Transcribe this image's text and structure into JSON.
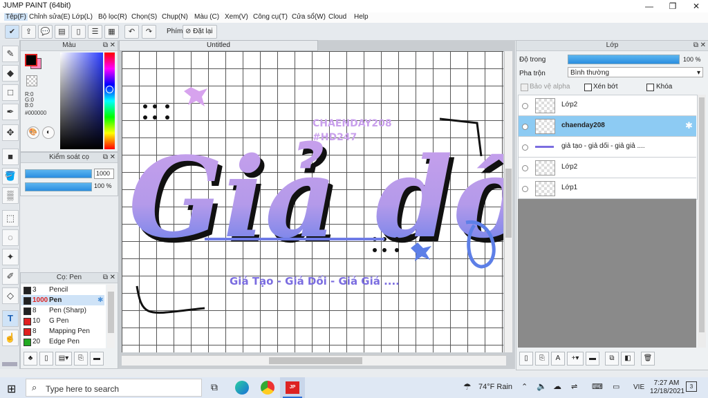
{
  "window": {
    "title": "JUMP PAINT (64bit)",
    "min": "—",
    "max": "❐",
    "close": "✕"
  },
  "menu": [
    "Tệp(F)",
    "Chỉnh sửa(E)",
    "Lớp(L)",
    "Bộ lọc(R)",
    "Chọn(S)",
    "Chụp(N)",
    "Màu (C)",
    "Xem(V)",
    "Công cụ(T)",
    "Cửa sổ(W)",
    "Cloud",
    "Help"
  ],
  "toolbar": {
    "phim_label": "Phím",
    "reset_label": "Đặt lại"
  },
  "color_panel": {
    "title": "Màu",
    "r": "R:0",
    "g": "G:0",
    "b": "B:0",
    "hex": "#000000",
    "fg": "#000000",
    "bg": "#ff88bb"
  },
  "pen_control": {
    "title": "Kiểm soát cọ",
    "size": "1000",
    "opacity": "100 %"
  },
  "brush_panel": {
    "title": "Cọ: Pen",
    "items": [
      {
        "size": "3",
        "name": "Pencil",
        "color": "#222222"
      },
      {
        "size": "1000",
        "name": "Pen",
        "color": "#222222",
        "selected": true
      },
      {
        "size": "8",
        "name": "Pen (Sharp)",
        "color": "#222222"
      },
      {
        "size": "10",
        "name": "G Pen",
        "color": "#e02020"
      },
      {
        "size": "8",
        "name": "Mapping Pen",
        "color": "#e02020"
      },
      {
        "size": "20",
        "name": "Edge Pen",
        "color": "#22aa22"
      }
    ]
  },
  "document": {
    "tab": "Untitled",
    "small_text_1": "CHAENDAY208",
    "small_text_2": "#HD247",
    "main_text": "Giả dối",
    "subtitle": "Giả Tạo - Giả Dối - Giả Giả ...."
  },
  "layer_panel": {
    "title": "Lớp",
    "opacity_label": "Độ trong",
    "opacity_value": "100 %",
    "blend_label": "Pha trộn",
    "blend_value": "Bình thường",
    "protect_alpha": "Bảo vệ alpha",
    "clip": "Xén bớt",
    "lock": "Khóa",
    "layers": [
      {
        "name": "Lớp2",
        "selected": false
      },
      {
        "name": "chaenday208",
        "selected": true
      },
      {
        "name": "giả tạo - giả dối - giả giả ....",
        "selected": false
      },
      {
        "name": "Lớp2",
        "selected": false
      },
      {
        "name": "Lớp1",
        "selected": false
      }
    ]
  },
  "taskbar": {
    "search_placeholder": "Type here to search",
    "weather": "74°F  Rain",
    "lang": "VIE",
    "time": "7:27 AM",
    "date": "12/18/2021",
    "notif": "3"
  }
}
